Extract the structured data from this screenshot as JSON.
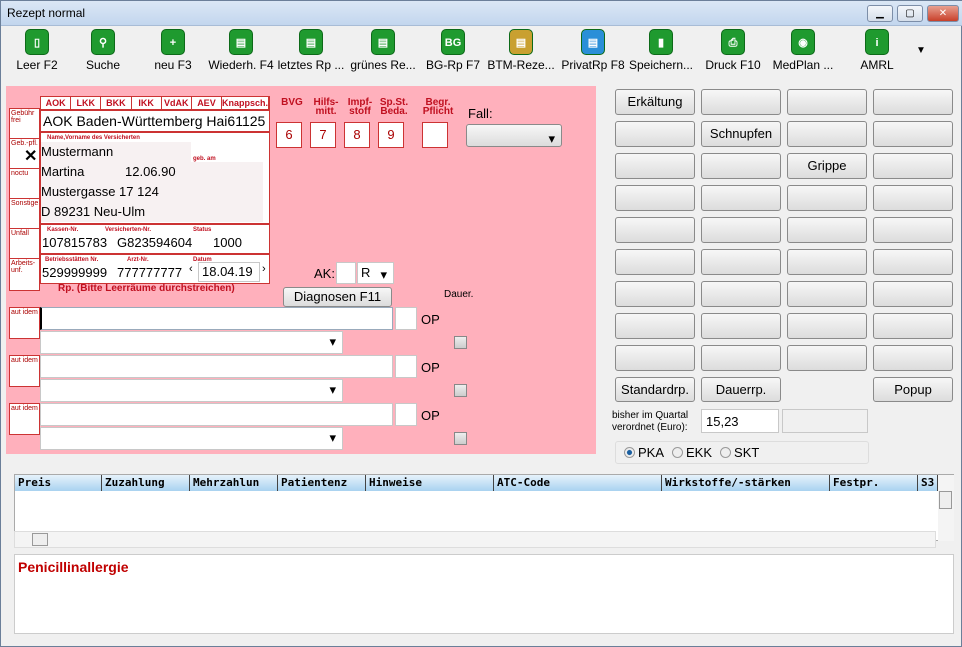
{
  "window": {
    "title": "Rezept normal"
  },
  "toolbar": [
    {
      "label": "Leer F2",
      "icon": "blank-page-icon",
      "glyph": "▯",
      "color": "#1f9a2f"
    },
    {
      "label": "Suche",
      "icon": "search-icon",
      "glyph": "⚲",
      "color": "#1f9a2f"
    },
    {
      "label": "neu F3",
      "icon": "new-bottle-icon",
      "glyph": "+",
      "color": "#1f9a2f"
    },
    {
      "label": "Wiederh. F4",
      "icon": "repeat-prescription-icon",
      "glyph": "▤",
      "color": "#1f9a2f"
    },
    {
      "label": "letztes Rp ...",
      "icon": "last-prescription-icon",
      "glyph": "▤",
      "color": "#1f9a2f"
    },
    {
      "label": "grünes Re...",
      "icon": "green-prescription-icon",
      "glyph": "▤",
      "color": "#1f9a2f"
    },
    {
      "label": "BG-Rp F7",
      "icon": "bg-prescription-icon",
      "glyph": "BG",
      "color": "#1f9a2f"
    },
    {
      "label": "BTM-Reze...",
      "icon": "btm-prescription-icon",
      "glyph": "▤",
      "color": "#c9a030"
    },
    {
      "label": "PrivatRp F8",
      "icon": "private-prescription-icon",
      "glyph": "▤",
      "color": "#2a8fd8"
    },
    {
      "label": "Speichern...",
      "icon": "save-icon",
      "glyph": "▮",
      "color": "#1f9a2f"
    },
    {
      "label": "Druck F10",
      "icon": "print-icon",
      "glyph": "⎙",
      "color": "#1f9a2f"
    },
    {
      "label": "MedPlan ...",
      "icon": "medplan-icon",
      "glyph": "◉",
      "color": "#1f9a2f"
    },
    {
      "label": "AMRL",
      "icon": "info-icon",
      "glyph": "i",
      "color": "#1f9a2f"
    }
  ],
  "form": {
    "kassen": [
      "AOK",
      "LKK",
      "BKK",
      "IKK",
      "VdAK",
      "AEV",
      "Knappsch."
    ],
    "side_labels": [
      "Gebühr frei",
      "Geb.-pfl.",
      "noctu",
      "Sonstige",
      "Unfall",
      "Arbeits-unf."
    ],
    "kasse_name": "AOK Baden-Württemberg Hai61125",
    "name_label": "Name,Vorname des Versicherten",
    "geb_label": "geb. am",
    "lastname": "Mustermann",
    "firstname": "Martina",
    "birthdate": "12.06.90",
    "street": "Mustergasse 17 124",
    "city": "D 89231 Neu-Ulm",
    "kassen_nr_label": "Kassen-Nr.",
    "versicherten_nr_label": "Versicherten-Nr.",
    "status_label": "Status",
    "kassen_nr": "107815783",
    "versicherten_nr": "G823594604",
    "status": "1000",
    "betriebsstaetten_label": "Betriebsstätten Nr.",
    "arzt_nr_label": "Arzt-Nr.",
    "datum_label": "Datum",
    "betriebsstaetten_nr": "529999999",
    "arzt_nr": "777777777",
    "datum": "18.04.19",
    "rp_note": "Rp. (Bitte Leerräume durchstreichen)",
    "markers": [
      {
        "label": "BVG",
        "value": "6"
      },
      {
        "label": "Hilfs-mitt.",
        "value": "7"
      },
      {
        "label": "Impf-stoff",
        "value": "8"
      },
      {
        "label": "Sp.St. Beda.",
        "value": "9"
      },
      {
        "label": "Begr. Pflicht",
        "value": ""
      }
    ],
    "fall_label": "Fall:",
    "fall_value": "",
    "ak_label": "AK:",
    "ak_value": "",
    "ak_select": "R",
    "diagnosen_button": "Diagnosen F11",
    "dauer_label": "Dauer.",
    "aut_idem": "aut idem",
    "op_label": "OP"
  },
  "grid_buttons": [
    "Erkältung",
    "",
    "",
    "",
    "",
    "Schnupfen",
    "",
    "",
    "",
    "",
    "Grippe",
    "",
    "",
    "",
    "",
    "",
    "",
    "",
    "",
    "",
    "",
    "",
    "",
    "",
    "",
    "",
    "",
    "",
    "",
    "",
    "",
    "",
    "",
    "",
    "",
    ""
  ],
  "bottom_buttons": {
    "standard": "Standardrp.",
    "dauer": "Dauerrp.",
    "popup": "Popup"
  },
  "quartal": {
    "label1": "bisher im Quartal",
    "label2": "verordnet (Euro):",
    "value": "15,23"
  },
  "radios": [
    {
      "label": "PKA",
      "checked": true
    },
    {
      "label": "EKK",
      "checked": false
    },
    {
      "label": "SKT",
      "checked": false
    }
  ],
  "table": {
    "columns": [
      "Preis",
      "Zuzahlung",
      "Mehrzahlun",
      "Patientenz",
      "Hinweise",
      "ATC-Code",
      "Wirkstoffe/-stärken",
      "Festpr.",
      "S3"
    ]
  },
  "notes": {
    "text": "Penicillinallergie",
    "color": "#c00000"
  }
}
